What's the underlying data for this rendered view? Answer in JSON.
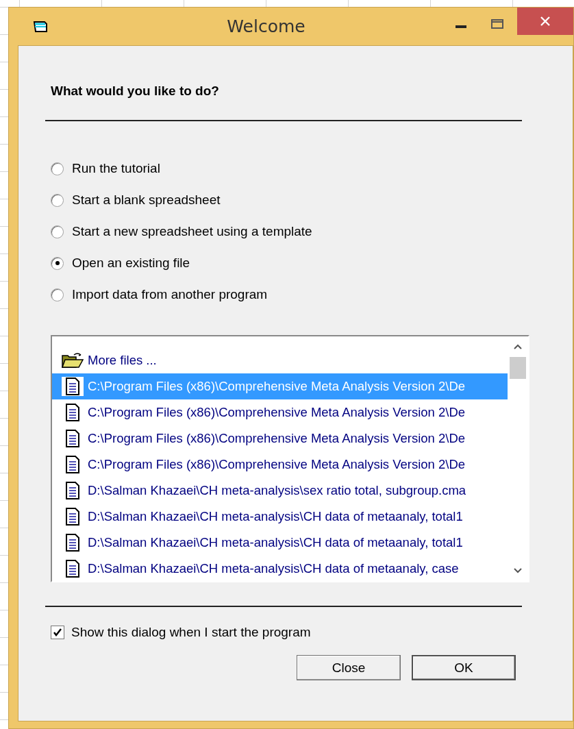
{
  "window": {
    "title": "Welcome"
  },
  "heading": "What would you like to do?",
  "options": [
    {
      "label": "Run the tutorial",
      "selected": false
    },
    {
      "label": "Start a blank spreadsheet",
      "selected": false
    },
    {
      "label": "Start a new spreadsheet using a template",
      "selected": false
    },
    {
      "label": "Open an existing file",
      "selected": true
    },
    {
      "label": "Import data from another program",
      "selected": false
    }
  ],
  "files": [
    {
      "kind": "folder",
      "label": "More files ...",
      "selected": false
    },
    {
      "kind": "file",
      "label": "C:\\Program Files (x86)\\Comprehensive Meta Analysis Version 2\\De",
      "selected": true
    },
    {
      "kind": "file",
      "label": "C:\\Program Files (x86)\\Comprehensive Meta Analysis Version 2\\De",
      "selected": false
    },
    {
      "kind": "file",
      "label": "C:\\Program Files (x86)\\Comprehensive Meta Analysis Version 2\\De",
      "selected": false
    },
    {
      "kind": "file",
      "label": "C:\\Program Files (x86)\\Comprehensive Meta Analysis Version 2\\De",
      "selected": false
    },
    {
      "kind": "file",
      "label": "D:\\Salman Khazaei\\CH meta-analysis\\sex ratio total, subgroup.cma",
      "selected": false
    },
    {
      "kind": "file",
      "label": "D:\\Salman Khazaei\\CH meta-analysis\\CH data of metaanaly, total1",
      "selected": false
    },
    {
      "kind": "file",
      "label": "D:\\Salman Khazaei\\CH meta-analysis\\CH data of metaanaly, total1",
      "selected": false
    },
    {
      "kind": "file",
      "label": "D:\\Salman Khazaei\\CH meta-analysis\\CH data of metaanaly, case",
      "selected": false
    }
  ],
  "show_dialog": {
    "label": "Show this dialog when I start the program",
    "checked": true
  },
  "buttons": [
    {
      "label": "Close",
      "default": false
    },
    {
      "label": "OK",
      "default": true
    }
  ]
}
